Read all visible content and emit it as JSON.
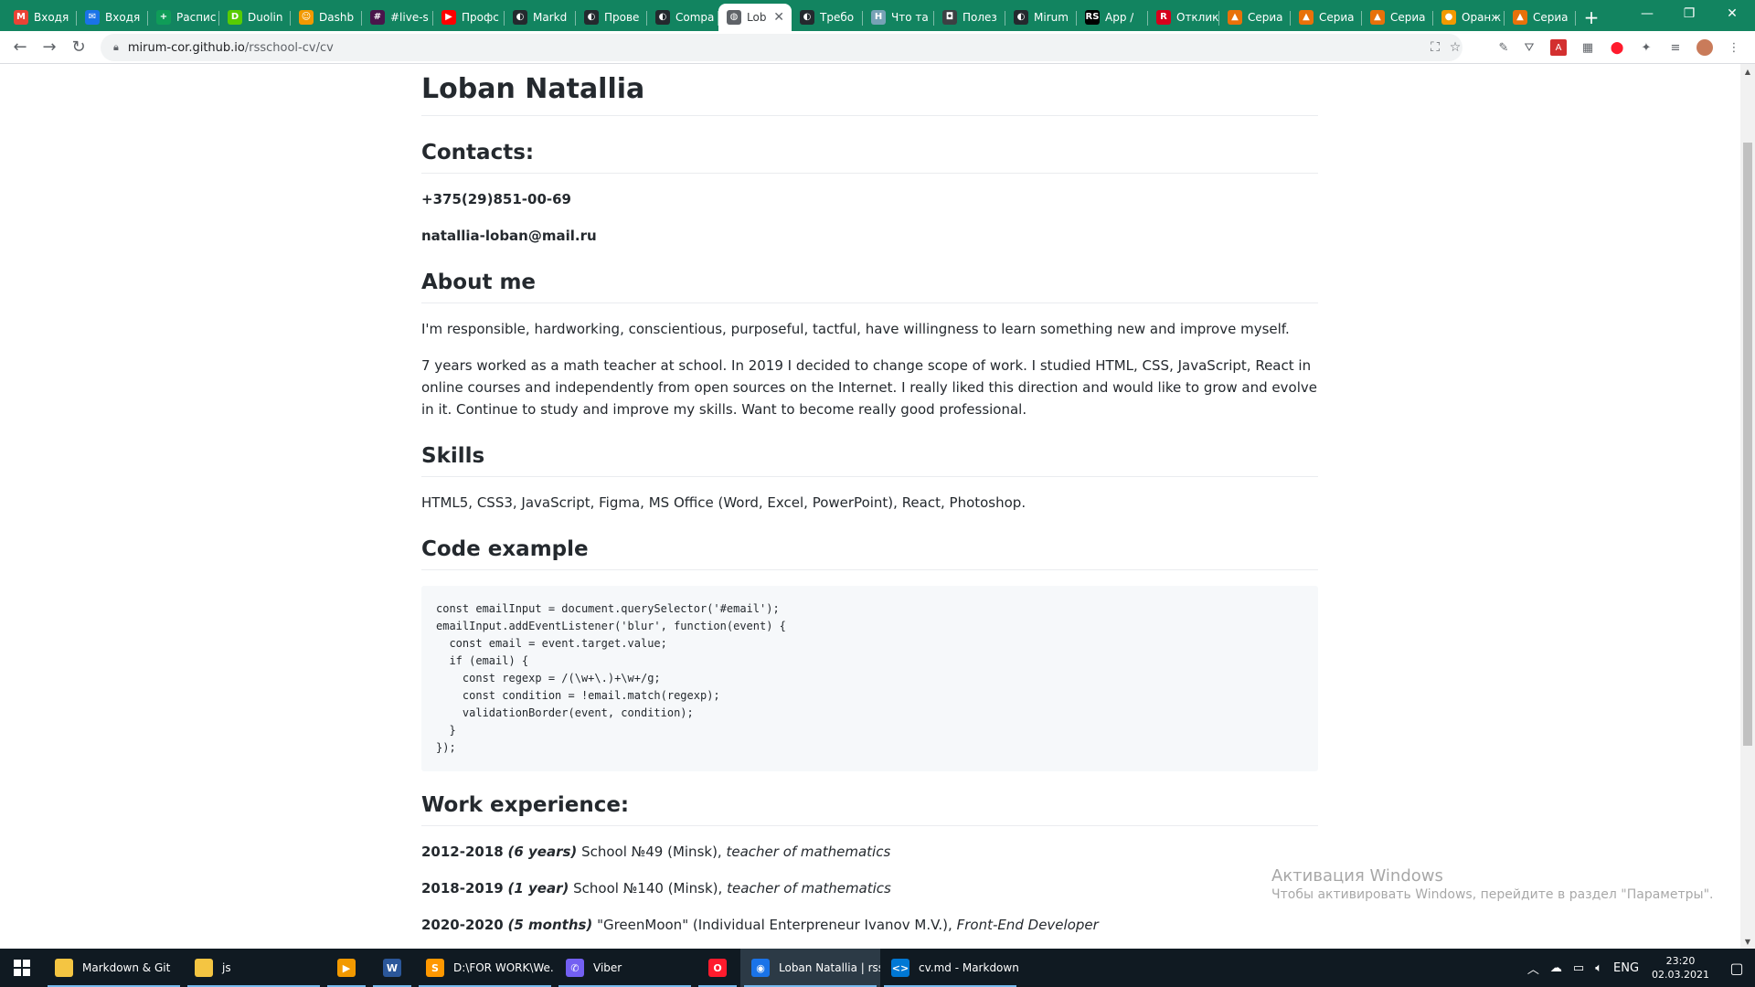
{
  "browser": {
    "tabs": [
      {
        "label": "Входя",
        "icon": "gmail-icon",
        "color": "#ea4335",
        "glyph": "M"
      },
      {
        "label": "Входя",
        "icon": "mail-icon",
        "color": "#1a73e8",
        "glyph": "✉"
      },
      {
        "label": "Распис",
        "icon": "schedule-icon",
        "color": "#0f9d58",
        "glyph": "+"
      },
      {
        "label": "Duolin",
        "icon": "duolingo-icon",
        "color": "#58cc02",
        "glyph": "D"
      },
      {
        "label": "Dashb",
        "icon": "dashboard-icon",
        "color": "#f29900",
        "glyph": "☺"
      },
      {
        "label": "#live-s",
        "icon": "slack-icon",
        "color": "#4a154b",
        "glyph": "#"
      },
      {
        "label": "Профс",
        "icon": "youtube-icon",
        "color": "#ff0000",
        "glyph": "▶"
      },
      {
        "label": "Markd",
        "icon": "github-icon",
        "color": "#24292e",
        "glyph": "◐"
      },
      {
        "label": "Прове",
        "icon": "github-icon",
        "color": "#24292e",
        "glyph": "◐"
      },
      {
        "label": "Compa",
        "icon": "github-icon",
        "color": "#24292e",
        "glyph": "◐"
      },
      {
        "label": "Lob",
        "icon": "globe-icon",
        "color": "#5f6368",
        "glyph": "◍",
        "active": true
      },
      {
        "label": "Требо",
        "icon": "github-icon",
        "color": "#24292e",
        "glyph": "◐"
      },
      {
        "label": "Что та",
        "icon": "habr-icon",
        "color": "#77a2b6",
        "glyph": "H"
      },
      {
        "label": "Полез",
        "icon": "shield-icon",
        "color": "#3c4043",
        "glyph": "◘"
      },
      {
        "label": "Mirum",
        "icon": "github-icon",
        "color": "#24292e",
        "glyph": "◐"
      },
      {
        "label": "App /",
        "icon": "rs-icon",
        "color": "#000000",
        "glyph": "RS"
      },
      {
        "label": "Отклик",
        "icon": "rabota-icon",
        "color": "#d6001c",
        "glyph": "R"
      },
      {
        "label": "Сериа",
        "icon": "flame-icon",
        "color": "#e8710a",
        "glyph": "▲"
      },
      {
        "label": "Сериа",
        "icon": "flame-icon",
        "color": "#e8710a",
        "glyph": "▲"
      },
      {
        "label": "Сериа",
        "icon": "flame-icon",
        "color": "#e8710a",
        "glyph": "▲"
      },
      {
        "label": "Оранж",
        "icon": "orange-icon",
        "color": "#f29900",
        "glyph": "●"
      },
      {
        "label": "Сериа",
        "icon": "flame-icon",
        "color": "#e8710a",
        "glyph": "▲"
      }
    ],
    "url_host": "mirum-cor.github.io",
    "url_path": "/rsschool-cv/cv",
    "tabstrip_color": "#128460"
  },
  "cv": {
    "name": "Loban Natallia",
    "contacts_heading": "Contacts:",
    "phone": "+375(29)851-00-69",
    "email": "natallia-loban@mail.ru",
    "about_heading": "About me",
    "about_p1": "I'm responsible, hardworking, conscientious, purposeful, tactful, have willingness to learn something new and improve myself.",
    "about_p2": "7 years worked as a math teacher at school. In 2019 I decided to change scope of work. I studied HTML, CSS, JavaScript, React in online courses and independently from open sources on the Internet. I really liked this direction and would like to grow and evolve in it. Continue to study and improve my skills. Want to become really good professional.",
    "skills_heading": "Skills",
    "skills_text": "HTML5, CSS3, JavaScript, Figma, MS Office (Word, Excel, PowerPoint), React, Photoshop.",
    "code_heading": "Code example",
    "code": "const emailInput = document.querySelector('#email');\nemailInput.addEventListener('blur', function(event) {\n  const email = event.target.value;\n  if (email) {\n    const regexp = /(\\w+\\.)+\\w+/g;\n    const condition = !email.match(regexp);\n    validationBorder(event, condition);\n  }\n});",
    "work_heading": "Work experience:",
    "jobs": [
      {
        "years": "2012-2018",
        "duration": "(6 years)",
        "place": "School №49 (Minsk),",
        "role": "teacher of mathematics"
      },
      {
        "years": "2018-2019",
        "duration": "(1 year)",
        "place": "School №140 (Minsk),",
        "role": "teacher of mathematics"
      },
      {
        "years": "2020-2020",
        "duration": "(5 months)",
        "place": "\"GreenMoon\" (Individual Enterpreneur Ivanov M.V.),",
        "role": "Front-End Developer"
      }
    ]
  },
  "watermark": {
    "title": "Активация Windows",
    "subtitle": "Чтобы активировать Windows, перейдите в раздел \"Параметры\"."
  },
  "taskbar": {
    "items": [
      {
        "label": "Markdown & Git",
        "icon": "folder-icon",
        "color": "#f4c542",
        "glyph": ""
      },
      {
        "label": "js",
        "icon": "folder-icon",
        "color": "#f4c542",
        "glyph": ""
      },
      {
        "label": "",
        "icon": "media-player-icon",
        "color": "#f29900",
        "glyph": "▶"
      },
      {
        "label": "",
        "icon": "word-icon",
        "color": "#2b579a",
        "glyph": "W"
      },
      {
        "label": "D:\\FOR WORK\\We...",
        "icon": "sublime-icon",
        "color": "#ff9800",
        "glyph": "S"
      },
      {
        "label": "Viber",
        "icon": "viber-icon",
        "color": "#7360f2",
        "glyph": "✆"
      },
      {
        "label": "",
        "icon": "opera-icon",
        "color": "#ff1b2d",
        "glyph": "O"
      },
      {
        "label": "Loban Natallia | rss...",
        "icon": "chrome-icon",
        "color": "#1a73e8",
        "glyph": "◉"
      },
      {
        "label": "cv.md - Markdown...",
        "icon": "vscode-icon",
        "color": "#0078d4",
        "glyph": "<>"
      }
    ],
    "language": "ENG",
    "time": "23:20",
    "date": "02.03.2021"
  }
}
